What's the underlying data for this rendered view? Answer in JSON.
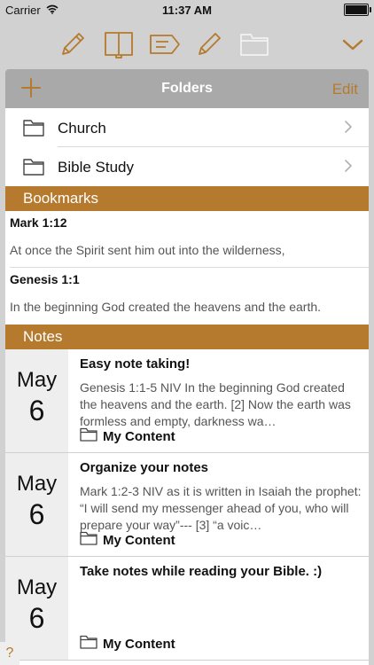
{
  "status": {
    "carrier": "Carrier",
    "time": "11:37 AM"
  },
  "toolbar": {
    "icons": [
      "pencil-icon",
      "book-icon",
      "tag-icon",
      "pencil-icon",
      "folder-icon"
    ],
    "collapse_icon": "chevron-down-icon"
  },
  "accent": "#b57a2d",
  "folders_header": {
    "title": "Folders",
    "edit_label": "Edit"
  },
  "folders": [
    {
      "label": "Church"
    },
    {
      "label": "Bible Study"
    }
  ],
  "bookmarks_header": "Bookmarks",
  "bookmarks": [
    {
      "ref": "Mark 1:12",
      "text": "At once the Spirit sent him out into the wilderness,"
    },
    {
      "ref": "Genesis 1:1",
      "text": "In the beginning God created the heavens and the earth."
    }
  ],
  "notes_header": "Notes",
  "notes": [
    {
      "month": "May",
      "day": "6",
      "title": "Easy note taking!",
      "preview": "Genesis 1:1-5 NIV In the beginning God created the heavens and the earth. [2] Now the earth was formless and empty, darkness wa…",
      "folder": "My Content"
    },
    {
      "month": "May",
      "day": "6",
      "title": "Organize your notes",
      "preview": "Mark 1:2-3 NIV as it is written in Isaiah the prophet:  “I will send my messenger ahead of you, who will prepare your way”--- [3] “a voic…",
      "folder": "My Content"
    },
    {
      "month": "May",
      "day": "6",
      "title": "Take notes while reading your Bible. :)",
      "preview": "",
      "folder": "My Content"
    }
  ],
  "help_label": "?"
}
